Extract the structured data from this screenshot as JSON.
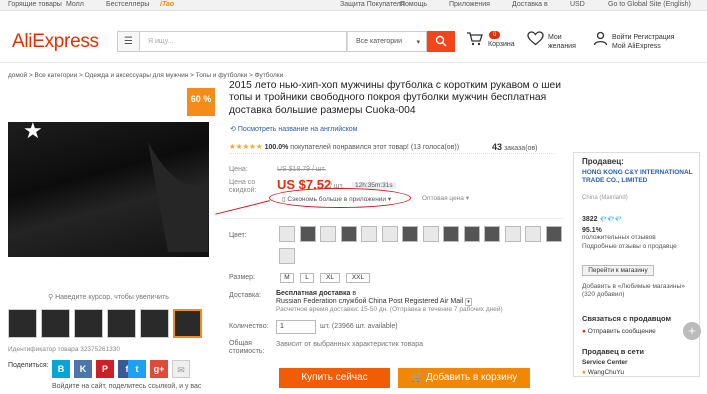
{
  "topbar": {
    "hot": "Горящие товары",
    "mall": "Молл",
    "bestsellers": "Бестселлеры",
    "taobao": "iTao",
    "protection": "Защита Покупателя",
    "help": "Помощь",
    "apps": "Приложения",
    "ship_to": "Доставка в",
    "currency": "USD",
    "global": "Go to Global Site (English)"
  },
  "header": {
    "logo": "AliExpress",
    "search_placeholder": "Я ищу...",
    "search_category": "Все категории",
    "cart_count": "0",
    "cart_label": "Корзина",
    "wish_line1": "Мои",
    "wish_line2": "желания",
    "account_line1": "Войти  Регистрация",
    "account_line2": "Мой AliExpress"
  },
  "breadcrumbs": "домой > Все категории > Одежда и аксессуары для мужчин > Топы и футболки > Футболки",
  "gallery": {
    "discount": "60 %",
    "zoom_hint": "Наведите курсор, чтобы увеличить",
    "product_id": "Идентификатор товара 32375261330",
    "share_label": "Поделиться:",
    "share_text": "Войдите на сайт, поделитесь ссылкой, и у вас",
    "social": [
      "B",
      "K",
      "P",
      "f",
      "t",
      "g+",
      "✉"
    ],
    "thumb_count": 6
  },
  "product": {
    "title": "2015 лето нью-хип-хоп мужчины футболка с коротким рукавом о шеи топы и тройники свободного покроя футболки мужчин бесплатная доставка большие размеры Cuoka-004",
    "translate_link": "Посмотреть название на английском",
    "stars": "★★★★★",
    "rating_percent": "100.0%",
    "rating_text": "покупателей понравился этот товар! (13 голоса(ов))",
    "orders_count": "43",
    "orders_label": "заказа(ов)",
    "price_label": "Цена:",
    "old_price": "US $18.79 / шт.",
    "discount_label_1": "Цена со",
    "discount_label_2": "скидкой:",
    "new_price": "US $7.52",
    "unit": "/ шт.",
    "timer": "12h:35m:31s",
    "app_save": "Сэкономь больше в приложении",
    "wholesale": "Оптовая цена",
    "color_label": "Цвет:",
    "color_swatches": [
      "white",
      "dark",
      "white",
      "dark",
      "white",
      "white",
      "dark",
      "white",
      "dark",
      "dark",
      "dark",
      "white",
      "white",
      "dark",
      "white"
    ],
    "size_label": "Размер:",
    "sizes": [
      "M",
      "L",
      "XL",
      "XXL"
    ],
    "shipping_label": "Доставка:",
    "shipping_title": "Бесплатная доставка",
    "shipping_in": "в",
    "shipping_dest": "Russian Federation службой China Post Registered Air Mail",
    "shipping_est": "Расчетное время доставки: 15-50 дн. (Отправка в течение 7 рабочих дней)",
    "qty_label": "Количество:",
    "qty_value": "1",
    "qty_avail": "шт. (23966 шт. available)",
    "total_label_1": "Общая",
    "total_label_2": "стоимость:",
    "total_value": "Зависит от выбранных характеристик товара",
    "buy_now": "Купить сейчас",
    "add_cart": "Добавить в корзину"
  },
  "seller": {
    "heading": "Продавец:",
    "name": "HONG KONG C&Y INTERNATIONAL TRADE CO., LIMITED",
    "country": "China (Mainland)",
    "score": "3822",
    "diamonds": "💎💎💎",
    "positive": "95.1%",
    "positive_label": "положительных отзывов",
    "details": "Подробные отзывы о продавце",
    "follow": "Перейти к магазину",
    "fav": "Добавить в «Любимые магазины» (320 добавил)",
    "contact_heading": "Связаться с продавцом",
    "message": "Отправить сообщение",
    "online_heading": "Продавец в сети",
    "service": "Service Center",
    "person": "WangChuYu"
  }
}
